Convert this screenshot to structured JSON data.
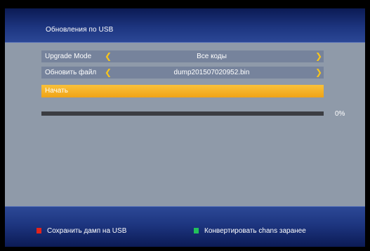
{
  "header": {
    "title": "Обновления по USB"
  },
  "menu": {
    "upgrade_mode": {
      "label": "Upgrade Mode",
      "value": "Все коды"
    },
    "update_file": {
      "label": "Обновить файл",
      "value": "dump201507020952.bin"
    },
    "start": {
      "label": "Начать"
    },
    "chevron_left": "❮",
    "chevron_right": "❯"
  },
  "progress": {
    "percent_text": "0%",
    "value": 0
  },
  "footer": {
    "red_hint": "Сохранить дамп на USB",
    "green_hint": "Конвертировать chans заранее"
  },
  "colors": {
    "red_key": "#e3231b",
    "green_key": "#22c15a",
    "highlight": "#f0a316"
  }
}
